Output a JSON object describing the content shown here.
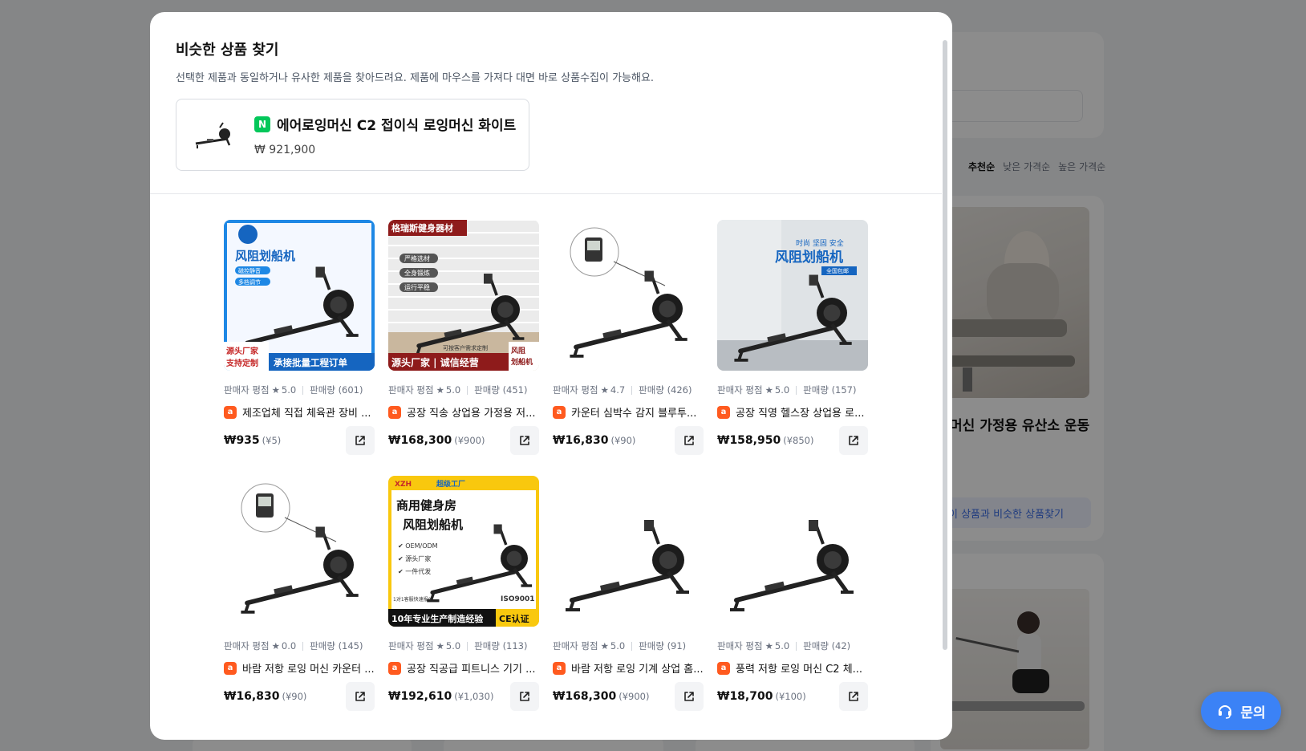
{
  "background": {
    "sort_options": [
      "추천순",
      "낮은 가격순",
      "높은 가격순"
    ],
    "product_title_partial": "머신 가정용 유산소 운동",
    "find_similar_partial": "이 상품과 비슷한 상품찾기"
  },
  "modal": {
    "title": "비슷한 상품 찾기",
    "description": "선택한 제품과 동일하거나 유사한 제품을 찾아드려요. 제품에 마우스를 가져다 대면 바로 상품수집이 가능해요.",
    "source": {
      "badge": "N",
      "title": "에어로잉머신 C2 접이식 로잉머신 화이트",
      "price": "₩ 921,900"
    },
    "products": [
      {
        "rating_label": "판매자 평점",
        "rating": "5.0",
        "sales": "판매량 (601)",
        "name": "제조업체 직접 체육관 장비 ...",
        "price": "₩935",
        "cny": "(¥5)",
        "style": "blue"
      },
      {
        "rating_label": "판매자 평점",
        "rating": "5.0",
        "sales": "판매량 (451)",
        "name": "공장 직송 상업용 가정용 저...",
        "price": "₩168,300",
        "cny": "(¥900)",
        "style": "brick"
      },
      {
        "rating_label": "판매자 평점",
        "rating": "4.7",
        "sales": "판매량 (426)",
        "name": "카운터 심박수 감지 블루투...",
        "price": "₩16,830",
        "cny": "(¥90)",
        "style": "plain-circle"
      },
      {
        "rating_label": "판매자 평점",
        "rating": "5.0",
        "sales": "판매량 (157)",
        "name": "공장 직영 헬스장 상업용 로...",
        "price": "₩158,950",
        "cny": "(¥850)",
        "style": "room"
      },
      {
        "rating_label": "판매자 평점",
        "rating": "0.0",
        "sales": "판매량 (145)",
        "name": "바람 저항 로잉 머신 카운터 ...",
        "price": "₩16,830",
        "cny": "(¥90)",
        "style": "plain-circle"
      },
      {
        "rating_label": "판매자 평점",
        "rating": "5.0",
        "sales": "판매량 (113)",
        "name": "공장 직공급 피트니스 기기 ...",
        "price": "₩192,610",
        "cny": "(¥1,030)",
        "style": "yellow"
      },
      {
        "rating_label": "판매자 평점",
        "rating": "5.0",
        "sales": "판매량 (91)",
        "name": "바람 저항 로잉 기계 상업 홈...",
        "price": "₩168,300",
        "cny": "(¥900)",
        "style": "plain"
      },
      {
        "rating_label": "판매자 평점",
        "rating": "5.0",
        "sales": "판매량 (42)",
        "name": "풍력 저항 로잉 머신 C2 체...",
        "price": "₩18,700",
        "cny": "(¥100)",
        "style": "plain"
      }
    ],
    "image_texts": {
      "blue_title": "风阻划船机",
      "blue_chip_1": "磁控静音",
      "blue_chip_2": "多档调节",
      "blue_bottom_left": "源头厂家 支持定制",
      "blue_bottom_right": "承接批量工程订单",
      "brick_top": "格瑞斯健身器材",
      "brick_chips": [
        "严格选材",
        "全身锻炼",
        "运行平稳"
      ],
      "brick_bottom": "源头厂家 | 诚信经营",
      "brick_corner": "风阻划船机",
      "brick_note": "可按客户需求定制",
      "room_top": "时尚 坚固 安全",
      "room_title": "风阻划船机",
      "room_chip": "全国包邮",
      "yellow_top_1": "XZH",
      "yellow_top_2": "超级工厂",
      "yellow_title_1": "商用健身房",
      "yellow_title_2": "风阻划船机",
      "yellow_list": [
        "OEM/ODM",
        "源头厂家",
        "一件代发"
      ],
      "yellow_note": "1对1客服快速报价",
      "yellow_iso": "ISO9001",
      "yellow_bottom": "10年专业生产制造经验",
      "yellow_ce": "CE认证"
    }
  },
  "inquiry_button": "문의",
  "colors": {
    "accent": "#3b82f6",
    "naver": "#03c75a",
    "ali": "#ff5a1f",
    "overlay": "rgba(0,0,0,0.45)"
  }
}
